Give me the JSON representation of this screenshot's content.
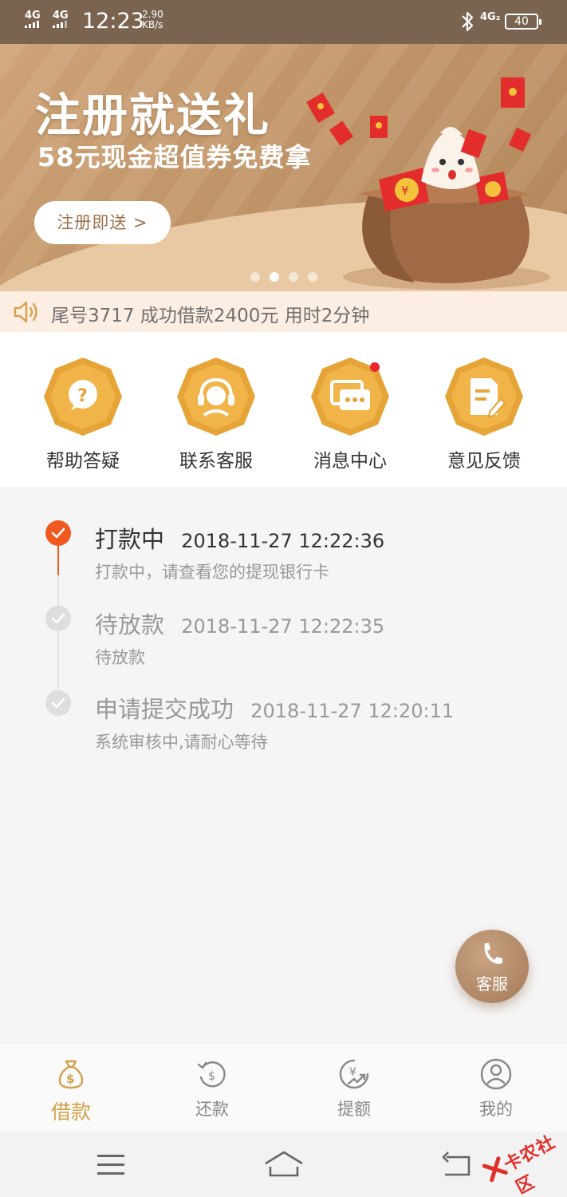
{
  "status_bar": {
    "signal_1": "4G",
    "signal_2": "4G",
    "time": "12:23",
    "speed_value": "2.90",
    "speed_unit": "KB/s",
    "network_2": "4G₂",
    "battery": "40"
  },
  "banner": {
    "title": "注册就送礼",
    "subtitle": "58元现金超值券免费拿",
    "button_label": "注册即送 >",
    "page_count": 4,
    "active_page": 2
  },
  "marquee": {
    "text": "尾号3717 成功借款2400元 用时2分钟"
  },
  "quick_actions": [
    {
      "label": "帮助答疑",
      "icon": "question-icon"
    },
    {
      "label": "联系客服",
      "icon": "headset-icon"
    },
    {
      "label": "消息中心",
      "icon": "message-icon",
      "badge": true
    },
    {
      "label": "意见反馈",
      "icon": "feedback-icon"
    }
  ],
  "timeline": [
    {
      "status": "打款中",
      "time": "2018-11-27 12:22:36",
      "desc": "打款中，请查看您的提现银行卡",
      "active": true
    },
    {
      "status": "待放款",
      "time": "2018-11-27 12:22:35",
      "desc": "待放款",
      "active": false
    },
    {
      "status": "申请提交成功",
      "time": "2018-11-27 12:20:11",
      "desc": "系统审核中,请耐心等待",
      "active": false
    }
  ],
  "fab": {
    "label": "客服"
  },
  "tabs": [
    {
      "label": "借款",
      "icon": "money-bag-icon",
      "active": true
    },
    {
      "label": "还款",
      "icon": "repay-icon",
      "active": false
    },
    {
      "label": "提额",
      "icon": "raise-limit-icon",
      "active": false
    },
    {
      "label": "我的",
      "icon": "user-icon",
      "active": false
    }
  ],
  "watermark": "卡农社区",
  "colors": {
    "accent": "#d4a24c",
    "active_step": "#f05a1e",
    "inactive_step": "#d9d9d9",
    "banner": "#c5996c",
    "badge": "#e8262b"
  }
}
